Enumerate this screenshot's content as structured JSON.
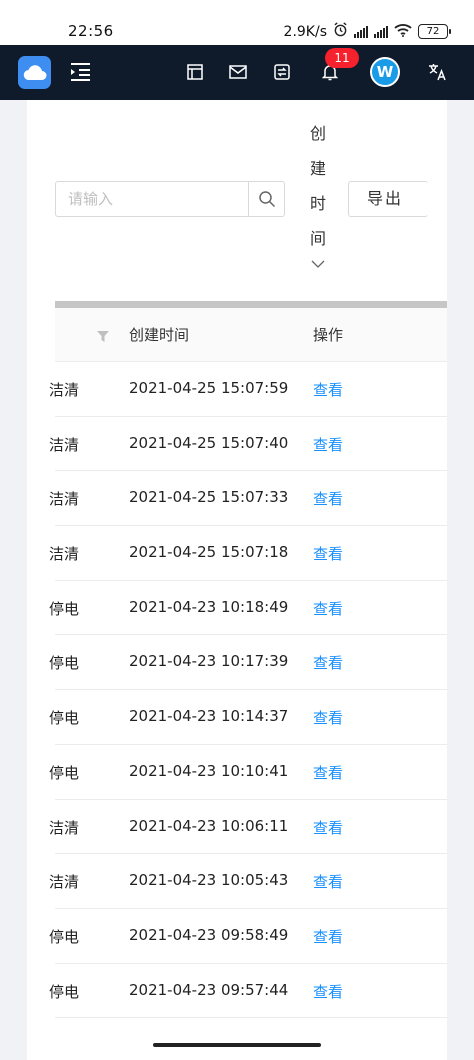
{
  "status_bar": {
    "time": "22:56",
    "net_speed": "2.9K/s",
    "battery": "72"
  },
  "navbar": {
    "notification_count": "11",
    "avatar_letter": "W"
  },
  "toolbar": {
    "search_placeholder": "请输入",
    "sort_label": [
      "创",
      "建",
      "时",
      "间"
    ],
    "export_label": "导出"
  },
  "table": {
    "headers": {
      "created_time": "创建时间",
      "actions": "操作"
    },
    "rows": [
      {
        "name": "洁清",
        "created_time": "2021-04-25 15:07:59",
        "action": "查看"
      },
      {
        "name": "洁清",
        "created_time": "2021-04-25 15:07:40",
        "action": "查看"
      },
      {
        "name": "洁清",
        "created_time": "2021-04-25 15:07:33",
        "action": "查看"
      },
      {
        "name": "洁清",
        "created_time": "2021-04-25 15:07:18",
        "action": "查看"
      },
      {
        "name": "停电",
        "created_time": "2021-04-23 10:18:49",
        "action": "查看"
      },
      {
        "name": "停电",
        "created_time": "2021-04-23 10:17:39",
        "action": "查看"
      },
      {
        "name": "停电",
        "created_time": "2021-04-23 10:14:37",
        "action": "查看"
      },
      {
        "name": "停电",
        "created_time": "2021-04-23 10:10:41",
        "action": "查看"
      },
      {
        "name": "洁清",
        "created_time": "2021-04-23 10:06:11",
        "action": "查看"
      },
      {
        "name": "洁清",
        "created_time": "2021-04-23 10:05:43",
        "action": "查看"
      },
      {
        "name": "停电",
        "created_time": "2021-04-23 09:58:49",
        "action": "查看"
      },
      {
        "name": "停电",
        "created_time": "2021-04-23 09:57:44",
        "action": "查看"
      }
    ]
  },
  "colors": {
    "nav_bg": "#0f1b2a",
    "link": "#1890ff",
    "badge": "#f5222d",
    "logo": "#3d8ef0"
  }
}
